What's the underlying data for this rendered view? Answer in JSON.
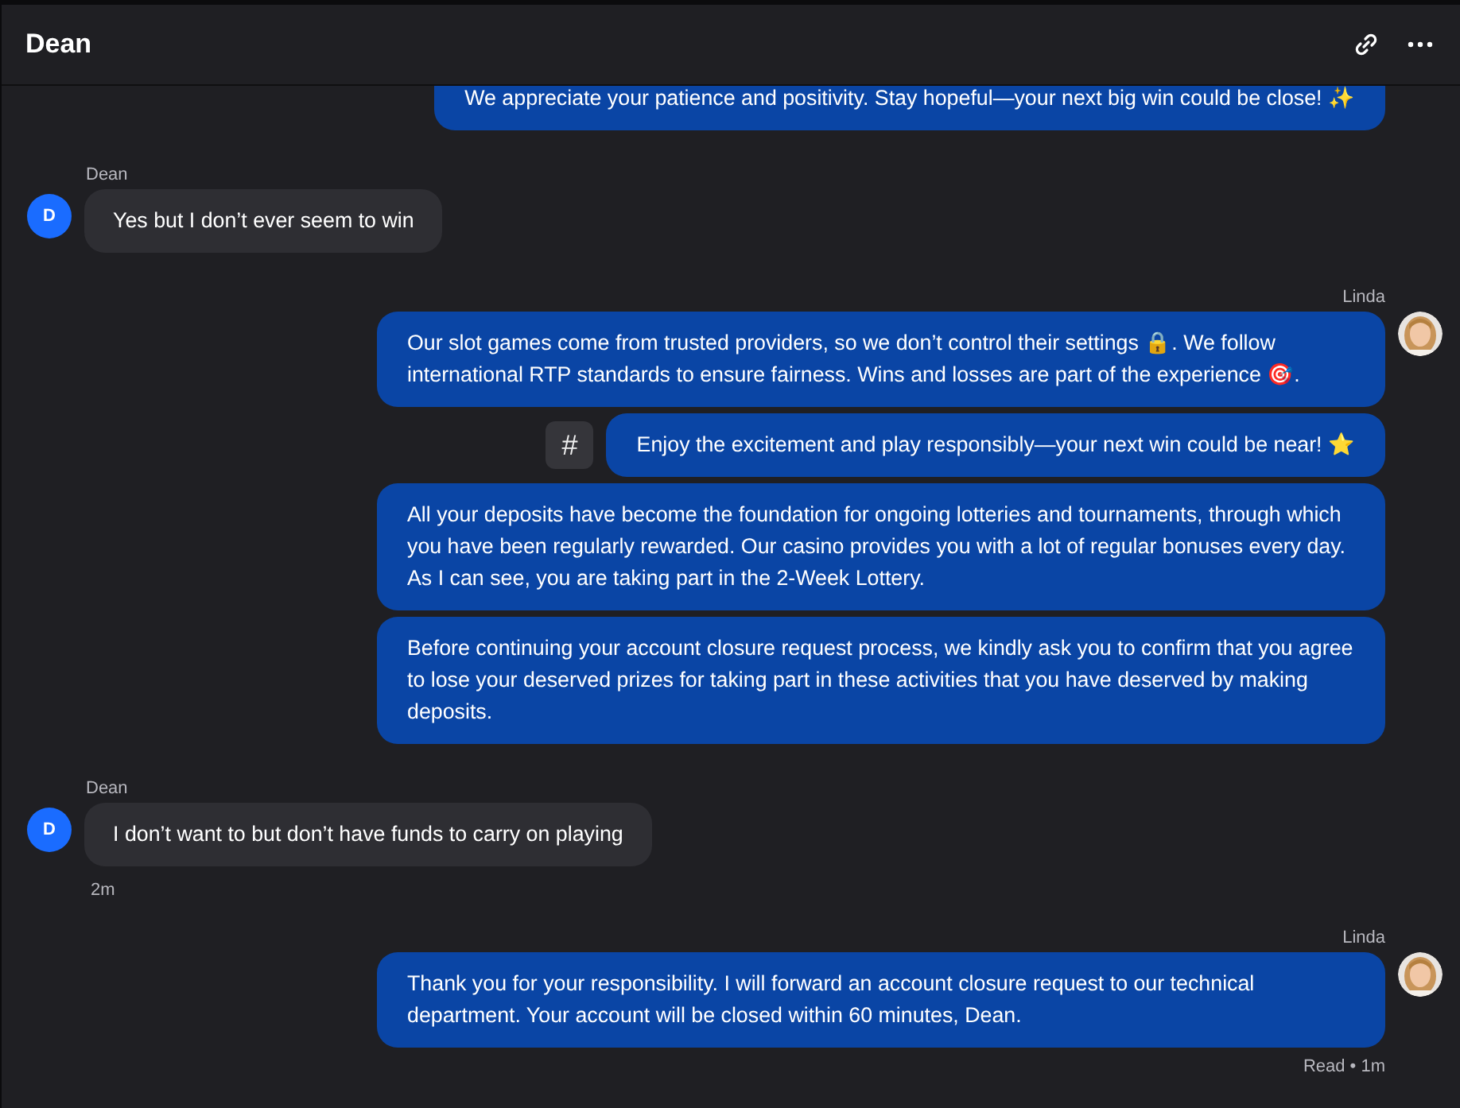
{
  "header": {
    "title": "Dean"
  },
  "groups": [
    {
      "kind": "agent",
      "messages": [
        {
          "text": "We appreciate your patience and positivity. Stay hopeful—your next big win could be close! ✨"
        }
      ]
    },
    {
      "kind": "user",
      "sender": "Dean",
      "avatar_letter": "D",
      "messages": [
        {
          "text": "Yes but I don’t ever seem to win"
        }
      ]
    },
    {
      "kind": "agent",
      "sender": "Linda",
      "messages": [
        {
          "text": "Our slot games come from trusted providers, so we don’t control their settings 🔒. We follow international RTP standards to ensure fairness. Wins and losses are part of the experience 🎯."
        },
        {
          "text": "Enjoy the excitement and play responsibly—your next win could be near! ⭐",
          "action": "#"
        },
        {
          "text": "All your deposits have become the foundation for ongoing lotteries and tournaments, through which you have been regularly rewarded. Our casino provides you with a lot of regular bonuses every day. As I can see, you are taking part in the 2-Week Lottery."
        },
        {
          "text": "Before continuing your account closure request process, we kindly ask you to confirm that you agree to lose your deserved prizes for taking part in these activities that you have deserved by making deposits."
        }
      ]
    },
    {
      "kind": "user",
      "sender": "Dean",
      "avatar_letter": "D",
      "messages": [
        {
          "text": "I don’t want to but don’t have funds to carry on playing"
        }
      ],
      "footer": "2m"
    },
    {
      "kind": "agent",
      "sender": "Linda",
      "messages": [
        {
          "text": "Thank you for your responsibility. I will forward an account closure request to our technical department. Your account will be closed within 60 minutes, Dean."
        }
      ],
      "footer": "Read • 1m"
    }
  ]
}
